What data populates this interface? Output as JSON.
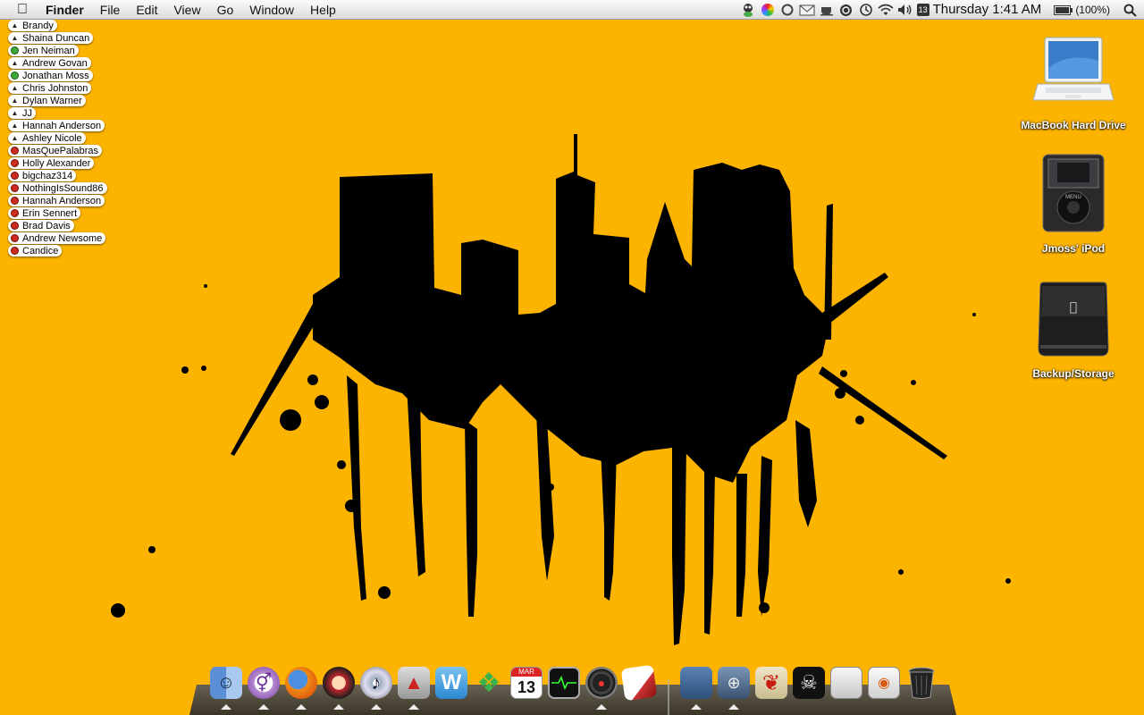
{
  "menubar": {
    "app_name": "Finder",
    "menus": [
      "File",
      "Edit",
      "View",
      "Go",
      "Window",
      "Help"
    ],
    "clock": "Thursday 1:41 AM",
    "calendar_date": "13",
    "battery": "(100%)",
    "battery_level": 1.0
  },
  "buddies": [
    {
      "name": "Brandy",
      "status": "wifi"
    },
    {
      "name": "Shaina Duncan",
      "status": "wifi"
    },
    {
      "name": "Jen Neiman",
      "status": "idle"
    },
    {
      "name": "Andrew Govan",
      "status": "wifi"
    },
    {
      "name": "Jonathan Moss",
      "status": "idle"
    },
    {
      "name": "Chris Johnston",
      "status": "wifi"
    },
    {
      "name": "Dylan Warner",
      "status": "wifi"
    },
    {
      "name": "JJ",
      "status": "wifi"
    },
    {
      "name": "Hannah Anderson",
      "status": "wifi"
    },
    {
      "name": "Ashley Nicole",
      "status": "wifi"
    },
    {
      "name": "MasQuePalabras",
      "status": "away"
    },
    {
      "name": "Holly Alexander",
      "status": "away"
    },
    {
      "name": "bigchaz314",
      "status": "away"
    },
    {
      "name": "NothingIsSound86",
      "status": "away"
    },
    {
      "name": "Hannah Anderson",
      "status": "away"
    },
    {
      "name": "Erin Sennert",
      "status": "away"
    },
    {
      "name": "Brad Davis",
      "status": "away"
    },
    {
      "name": "Andrew Newsome",
      "status": "away"
    },
    {
      "name": "Candice",
      "status": "away"
    }
  ],
  "desktop_icons": [
    {
      "label": "MacBook Hard Drive",
      "icon": "laptop-icon"
    },
    {
      "label": "Jmoss' iPod",
      "icon": "ipod-icon"
    },
    {
      "label": "Backup/Storage",
      "icon": "external-drive-icon"
    }
  ],
  "dock": {
    "calendar_month": "MAR",
    "calendar_day": "13"
  },
  "colors": {
    "desktop": "#fdb400",
    "ink": "#000000",
    "away": "#cc2b1e",
    "idle": "#3ea83a"
  }
}
